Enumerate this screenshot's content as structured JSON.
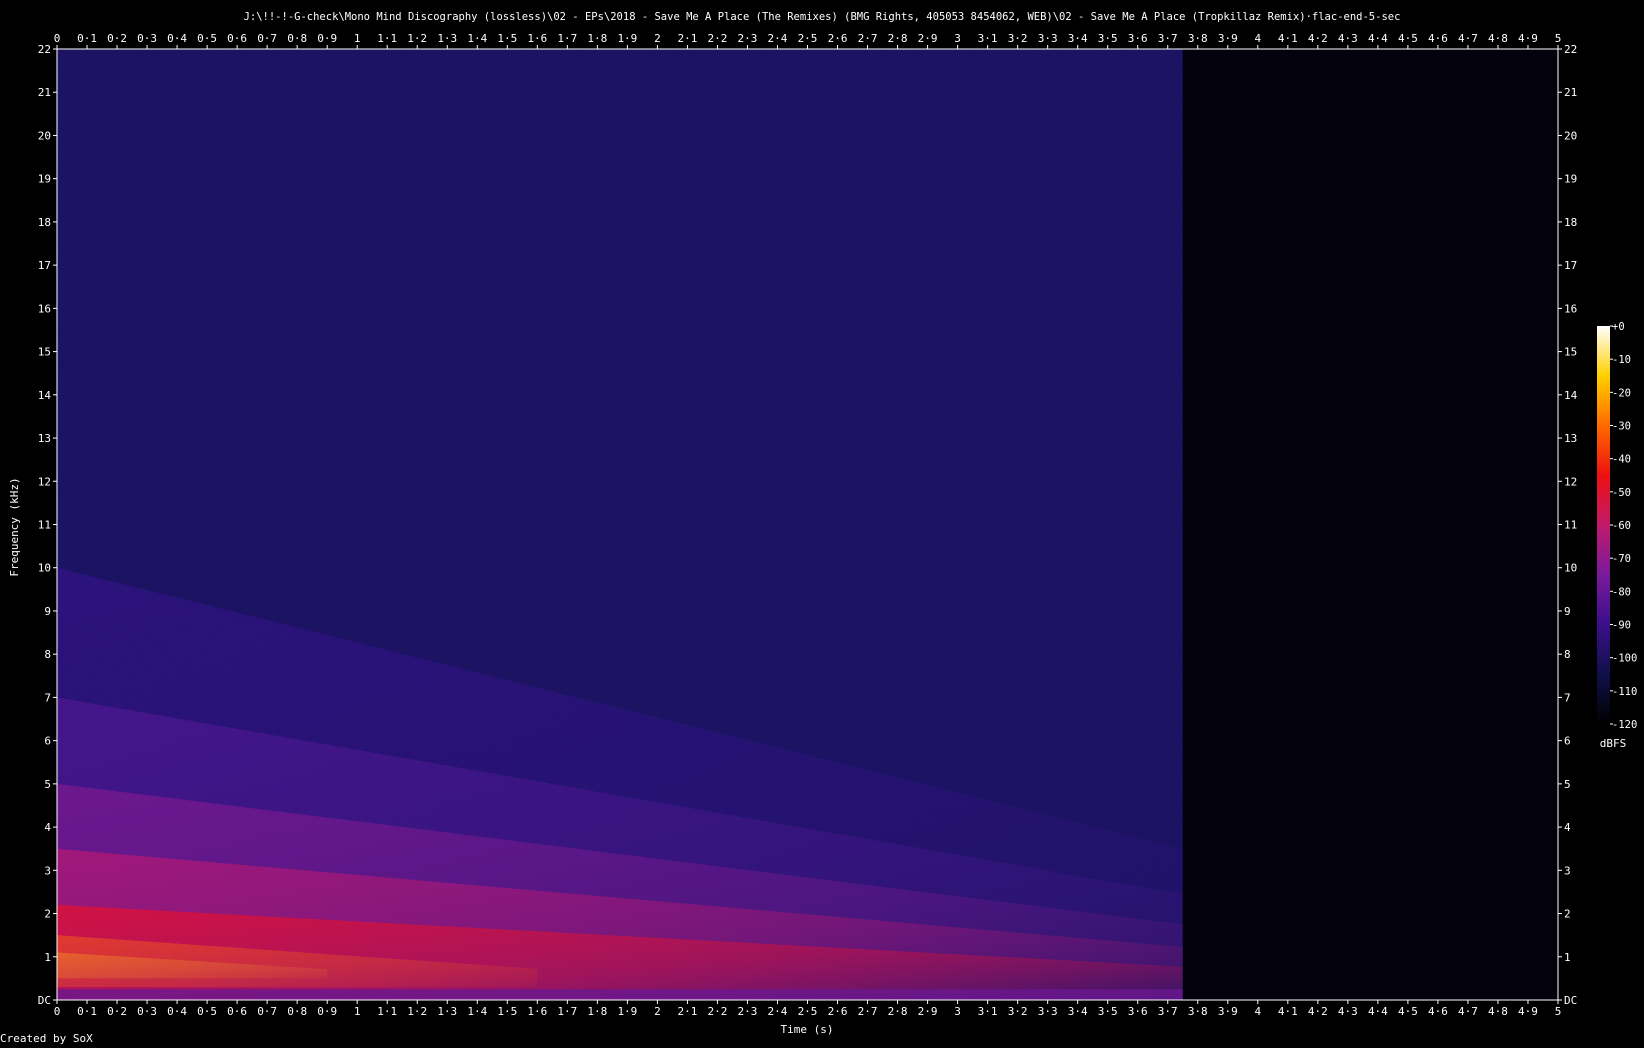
{
  "chart_data": {
    "type": "heatmap",
    "title": "J:\\!!-!-G-check\\Mono Mind Discography (lossless)\\02 - EPs\\2018 - Save Me A Place (The Remixes) (BMG Rights, 405053 8454062, WEB)\\02 - Save Me A Place (Tropkillaz Remix)·flac-end-5-sec",
    "xlabel": "Time (s)",
    "ylabel": "Frequency (kHz)",
    "xlim": [
      0,
      5
    ],
    "ylim": [
      0,
      22
    ],
    "x_ticks": [
      "0",
      "0·1",
      "0·2",
      "0·3",
      "0·4",
      "0·5",
      "0·6",
      "0·7",
      "0·8",
      "0·9",
      "1",
      "1·1",
      "1·2",
      "1·3",
      "1·4",
      "1·5",
      "1·6",
      "1·7",
      "1·8",
      "1·9",
      "2",
      "2·1",
      "2·2",
      "2·3",
      "2·4",
      "2·5",
      "2·6",
      "2·7",
      "2·8",
      "2·9",
      "3",
      "3·1",
      "3·2",
      "3·3",
      "3·4",
      "3·5",
      "3·6",
      "3·7",
      "3·8",
      "3·9",
      "4",
      "4·1",
      "4·2",
      "4·3",
      "4·4",
      "4·5",
      "4·6",
      "4·7",
      "4·8",
      "4·9",
      "5"
    ],
    "y_ticks": [
      "DC",
      "1",
      "2",
      "3",
      "4",
      "5",
      "6",
      "7",
      "8",
      "9",
      "10",
      "11",
      "12",
      "13",
      "14",
      "15",
      "16",
      "17",
      "18",
      "19",
      "20",
      "21",
      "22"
    ],
    "signal_end_time": 3.75,
    "colorbar": {
      "label": "dBFS",
      "range": [
        -120,
        0
      ],
      "ticks": [
        "+0",
        "-10",
        "-20",
        "-30",
        "-40",
        "-50",
        "-60",
        "-70",
        "-80",
        "-90",
        "-100",
        "-110",
        "-120"
      ],
      "colors": [
        "#000000",
        "#10104a",
        "#3a0f8a",
        "#7a1a9c",
        "#c01a6a",
        "#ee1010",
        "#ff6a00",
        "#ffd000",
        "#ffffff"
      ]
    },
    "background_color": "#000000",
    "noise_floor_color": "#1a1260",
    "footer": "Created by SoX"
  }
}
